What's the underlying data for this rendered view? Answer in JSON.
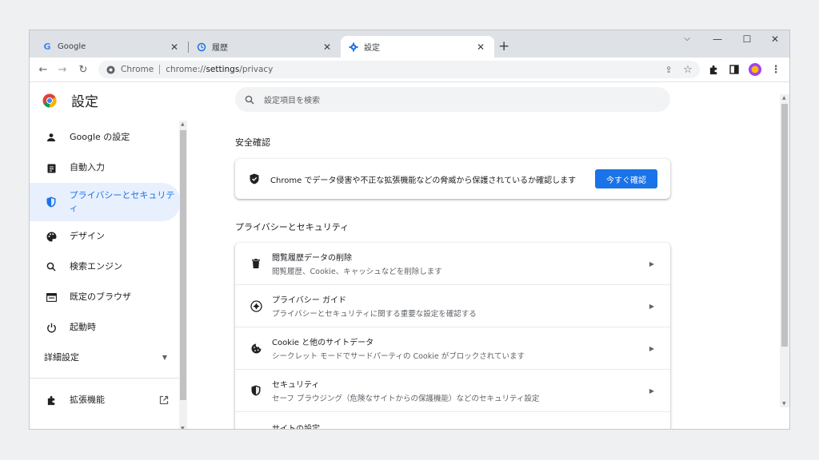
{
  "tabs": [
    {
      "title": "Google",
      "icon": "google-g-icon"
    },
    {
      "title": "履歴",
      "icon": "history-icon"
    },
    {
      "title": "設定",
      "icon": "settings-gear-icon"
    }
  ],
  "window_controls": [
    "minimize",
    "maximize",
    "close"
  ],
  "omnibox": {
    "chip": "Chrome",
    "url_prefix": "chrome://",
    "url_host": "settings",
    "url_path": "/privacy"
  },
  "brand": {
    "title": "設定"
  },
  "search": {
    "placeholder": "設定項目を検索"
  },
  "sidebar": {
    "items": [
      {
        "label": "Google の設定",
        "icon": "person-icon"
      },
      {
        "label": "自動入力",
        "icon": "clipboard-icon"
      },
      {
        "label": "プライバシーとセキュリティ",
        "icon": "shield-icon",
        "active": true
      },
      {
        "label": "デザイン",
        "icon": "palette-icon"
      },
      {
        "label": "検索エンジン",
        "icon": "search-icon"
      },
      {
        "label": "既定のブラウザ",
        "icon": "browser-icon"
      },
      {
        "label": "起動時",
        "icon": "power-icon"
      }
    ],
    "advanced": "詳細設定",
    "extensions": "拡張機能"
  },
  "safety_check": {
    "heading": "安全確認",
    "text": "Chrome でデータ侵害や不正な拡張機能などの脅威から保護されているか確認します",
    "button": "今すぐ確認"
  },
  "privacy": {
    "heading": "プライバシーとセキュリティ",
    "rows": [
      {
        "title": "閲覧履歴データの削除",
        "subtitle": "閲覧履歴、Cookie、キャッシュなどを削除します",
        "icon": "trash-icon"
      },
      {
        "title": "プライバシー ガイド",
        "subtitle": "プライバシーとセキュリティに関する重要な設定を確認する",
        "icon": "compass-icon"
      },
      {
        "title": "Cookie と他のサイトデータ",
        "subtitle": "シークレット モードでサードパーティの Cookie がブロックされています",
        "icon": "cookie-icon"
      },
      {
        "title": "セキュリティ",
        "subtitle": "セーフ ブラウジング（危険なサイトからの保護機能）などのセキュリティ設定",
        "icon": "shield-icon"
      },
      {
        "title": "サイトの設定",
        "subtitle": "",
        "icon": "tune-icon"
      }
    ]
  },
  "colors": {
    "accent": "#1a73e8",
    "active_bg": "#e8f0fe",
    "tabstrip": "#dee1e6"
  }
}
